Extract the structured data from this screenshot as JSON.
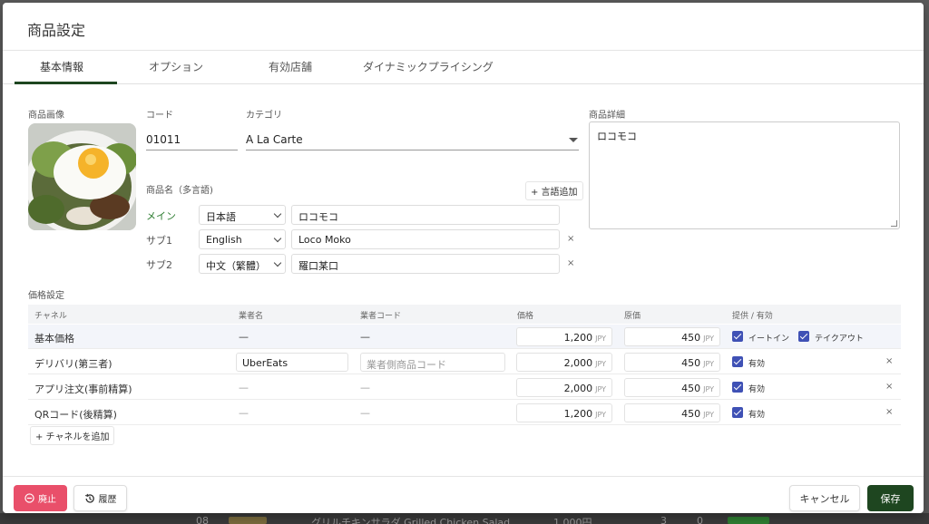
{
  "modal": {
    "title": "商品設定"
  },
  "tabs": [
    {
      "label": "基本情報",
      "active": true
    },
    {
      "label": "オプション",
      "active": false
    },
    {
      "label": "有効店舗",
      "active": false
    },
    {
      "label": "ダイナミックプライシング",
      "active": false
    }
  ],
  "basic": {
    "image_label": "商品画像",
    "code_label": "コード",
    "code_value": "01011",
    "category_label": "カテゴリ",
    "category_value": "A La Carte",
    "detail_label": "商品詳細",
    "detail_value": "ロコモコ",
    "names_label": "商品名（多言語)",
    "add_language": "+ 言語追加",
    "names": [
      {
        "role": "メイン",
        "language": "日本語",
        "value": "ロコモコ",
        "removable": false
      },
      {
        "role": "サブ1",
        "language": "English",
        "value": "Loco Moko",
        "removable": true
      },
      {
        "role": "サブ2",
        "language": "中文（繁體）",
        "value": "羅口某口",
        "removable": true
      }
    ],
    "remove_icon": "×"
  },
  "pricing": {
    "section_label": "価格設定",
    "headers": {
      "channel": "チャネル",
      "vendor_name": "業者名",
      "vendor_code": "業者コード",
      "price": "価格",
      "cost": "原価",
      "availability": "提供 / 有効"
    },
    "currency": "JPY",
    "rows": [
      {
        "channel": "基本価格",
        "vendor_name": "—",
        "vendor_code": "—",
        "price": "1,200",
        "cost": "450",
        "checks": [
          "イートイン",
          "テイクアウト"
        ],
        "removable": false
      },
      {
        "channel": "デリバリ(第三者)",
        "vendor_name": "UberEats",
        "vendor_code_placeholder": "業者側商品コード",
        "price": "2,000",
        "cost": "450",
        "checks": [
          "有効"
        ],
        "removable": true
      },
      {
        "channel": "アプリ注文(事前精算)",
        "vendor_name": "—",
        "vendor_code": "—",
        "price": "2,000",
        "cost": "450",
        "checks": [
          "有効"
        ],
        "removable": true
      },
      {
        "channel": "QRコード(後精算)",
        "vendor_name": "—",
        "vendor_code": "—",
        "price": "1,200",
        "cost": "450",
        "checks": [
          "有効"
        ],
        "removable": true
      }
    ],
    "add_channel": "+ チャネルを追加",
    "remove_icon": "×"
  },
  "footer": {
    "discontinue": "廃止",
    "history": "履歴",
    "cancel": "キャンセル",
    "save": "保存"
  },
  "background": {
    "row_number": "08",
    "row_name": "グリルチキンサラダ Grilled Chicken Salad",
    "row_price": "1,000円",
    "row_count_a": "3",
    "row_count_b": "0"
  },
  "colors": {
    "accent": "#1e4620",
    "danger": "#e94f6a",
    "checkbox": "#3f51b5",
    "main_language": "#2e7d32"
  }
}
